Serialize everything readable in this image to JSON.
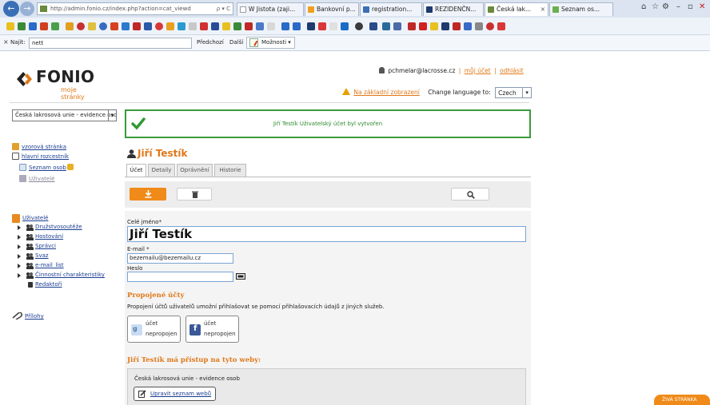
{
  "browser": {
    "address_url": "http://admin.fonio.cz/index.php?action=cat_viewd",
    "address_controls": "ρ ▾ C",
    "tabs": [
      {
        "label": "W Jistota (zaji...",
        "color": "#ffffff"
      },
      {
        "label": "Bankovní p...",
        "color": "#f0a020"
      },
      {
        "label": "registration...",
        "color": "#3b6fb5"
      },
      {
        "label": "REZIDENČN...",
        "color": "#1e3a6e"
      },
      {
        "label": "Česká lak...",
        "color": "#6a8a3c"
      },
      {
        "label": "Seznam os...",
        "color": "#6ab04c"
      }
    ],
    "tab_close": "×",
    "window_controls": [
      "⌂",
      "☆",
      "⚙",
      "–",
      "▫",
      "✕"
    ]
  },
  "findbar": {
    "close": "×",
    "label": "Najít:",
    "value": "nett",
    "prev": "Předchozí",
    "next": "Další",
    "options": "Možnosti ▾"
  },
  "logo": {
    "text": "FONIO",
    "subtitle": "moje stránky"
  },
  "userbar": {
    "email": "pchmelar@lacrosse.cz",
    "separator": "|",
    "my_account": "můj účet",
    "logout": "odhlásit"
  },
  "langbar": {
    "basic_view": "Na základní zobrazení",
    "change_language": "Change language to:",
    "language": "Czech",
    "arrow": "▾"
  },
  "sidebar": {
    "org": "Česká lakrosová unie - evidence osob",
    "arrow": "▾",
    "items": {
      "sample_page": "vzorová stránka",
      "main_signpost": "hlavní rozcestník",
      "person_list": "Seznam osob",
      "users": "Uživatelé",
      "users_section": "Uživatelé",
      "groups": [
        "Družstvosoutěže",
        "Hostování",
        "Správci",
        "Svaz",
        "e-mail_list",
        "Činnostní charakteristiky"
      ],
      "editors": "Redaktoři",
      "attachments": "Přílohy"
    }
  },
  "main": {
    "success_message": "Jiří Testík Uživatelský účet byl vytvořen",
    "user_title": "Jiří Testík",
    "tabs": [
      "Účet",
      "Detaily",
      "Oprávnění",
      "Historie"
    ],
    "form": {
      "name_label": "Celé jméno*",
      "name_value": "Jiří Testík",
      "email_label": "E-mail *",
      "email_value": "bezemailu@bezemailu.cz",
      "password_label": "Heslo",
      "linked_title": "Propojené účty",
      "linked_desc": "Propojení účtů uživatelů umožní přihlašovat se pomocí přihlašovacích údajů z jiných služeb.",
      "google": {
        "l1": "účet",
        "l2": "nepropojen",
        "color": "#c8ddf5"
      },
      "facebook": {
        "l1": "účet",
        "l2": "nepropojen",
        "color": "#3b5998"
      },
      "access_title": "Jiří Testík má přístup na tyto weby:",
      "web_org": "Česká lakrosová unie - evidence osob",
      "edit_webs": "Upravit seznam webů"
    }
  },
  "live_tab": "ŽIVÁ STRÁNKA",
  "colors": {
    "accent": "#e07818",
    "success": "#3a9a3a",
    "link": "#1a3d8f"
  }
}
